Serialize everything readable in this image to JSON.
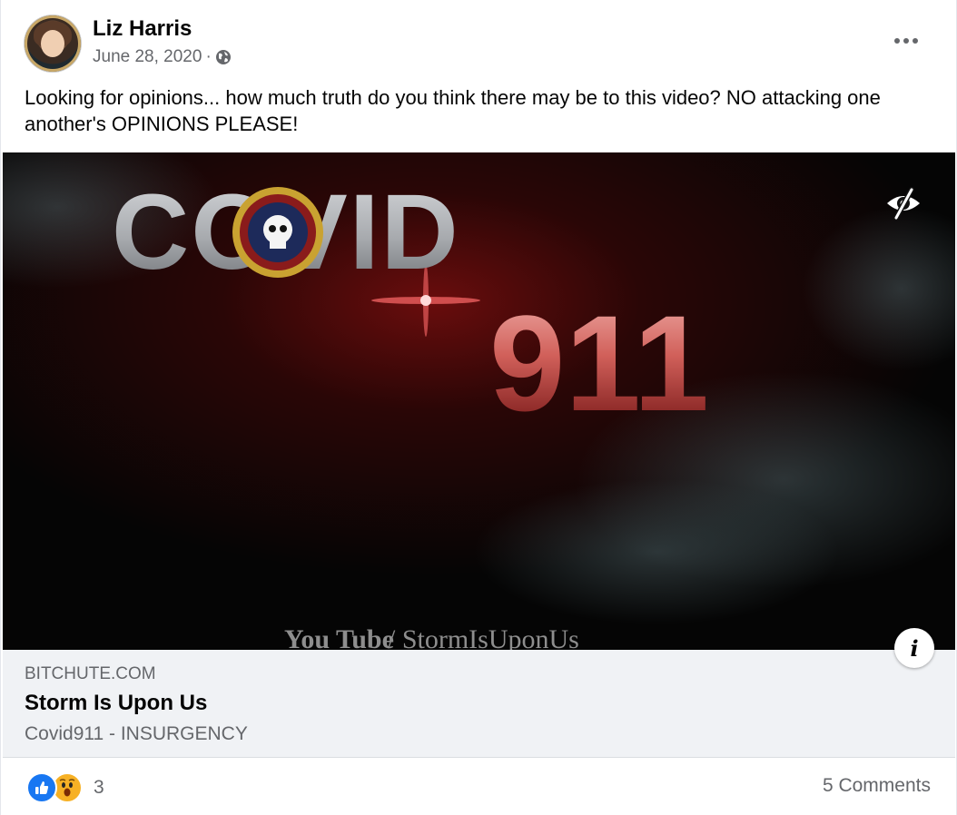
{
  "post": {
    "author": "Liz Harris",
    "date": "June 28, 2020",
    "separator": "·",
    "audience_icon": "globe-icon",
    "text": "Looking for opinions... how much truth do you think there may be to this video? NO attacking one another's OPINIONS PLEASE!"
  },
  "media": {
    "title_word": "COVID",
    "title_number": "911",
    "watermark_youtube": "You Tube",
    "watermark_channel": "/ StormIsUponUs",
    "hide_icon": "eye-slash-icon",
    "info_icon": "info-icon",
    "info_glyph": "i"
  },
  "link": {
    "domain": "BITCHUTE.COM",
    "title": "Storm Is Upon Us",
    "description": "Covid911 - INSURGENCY"
  },
  "footer": {
    "reaction_icons": [
      "like-icon",
      "wow-icon"
    ],
    "reaction_count": "3",
    "comments": "5 Comments"
  },
  "colors": {
    "accent_blue": "#1877f2",
    "wow_yellow": "#f7b125",
    "muted_text": "#65676b",
    "link_bg": "#f0f2f5"
  }
}
